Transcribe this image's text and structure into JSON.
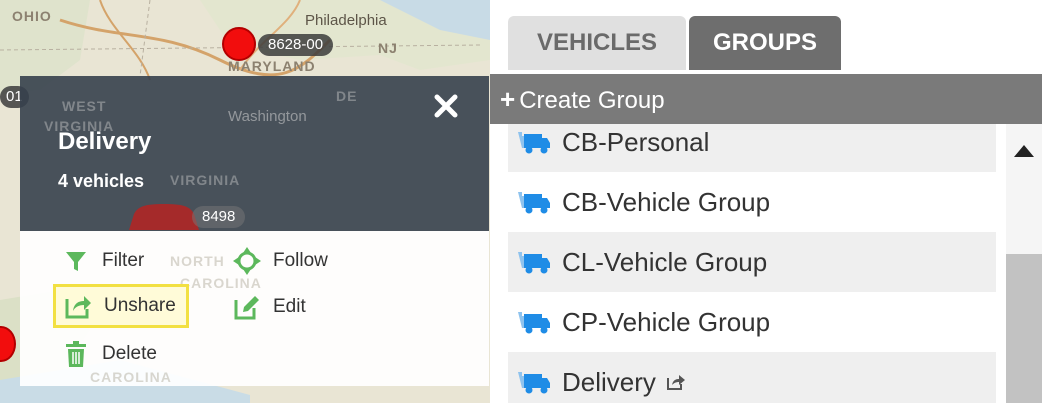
{
  "map": {
    "labels": {
      "ohio": "OHIO",
      "philadelphia": "Philadelphia",
      "nj": "NJ",
      "maryland": "MARYLAND",
      "de": "DE",
      "west_virginia_1": "WEST",
      "west_virginia_2": "VIRGINIA",
      "washington": "Washington",
      "virginia": "VIRGINIA",
      "north": "NORTH",
      "carolina": "CAROLINA",
      "south_carolina": "CAROLINA"
    },
    "markers": {
      "tag_1": "8628-00",
      "tag_2": "8498",
      "tag_3": "01"
    },
    "marker_color": "#f20d0d"
  },
  "popup": {
    "title": "Delivery",
    "subtitle": "4 vehicles",
    "close_icon": "close-x-icon",
    "actions": {
      "filter": "Filter",
      "follow": "Follow",
      "unshare": "Unshare",
      "edit": "Edit",
      "delete": "Delete"
    },
    "highlight_color": "#f2e042",
    "icon_color": "#5cb85c"
  },
  "panel": {
    "tabs": {
      "vehicles": "VEHICLES",
      "groups": "GROUPS"
    },
    "active_tab": "GROUPS",
    "create_label": "Create Group",
    "create_plus": "+",
    "groups": [
      {
        "name": "CB-Personal"
      },
      {
        "name": "CB-Vehicle Group"
      },
      {
        "name": "CL-Vehicle Group"
      },
      {
        "name": "CP-Vehicle Group"
      },
      {
        "name": "Delivery",
        "shared": true
      }
    ],
    "truck_icon_color": "#1f8ce6"
  }
}
